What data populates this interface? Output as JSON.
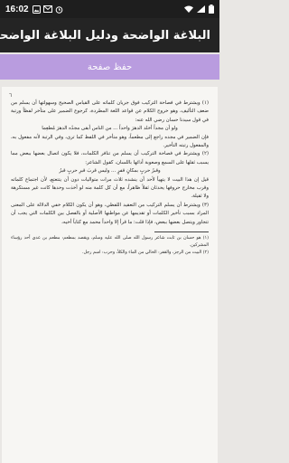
{
  "status_bar": {
    "time": "16:02",
    "left_icons": [
      "image-notification-icon",
      "mail-notification-icon",
      "alarm-icon"
    ],
    "right_icons": [
      "wifi-icon",
      "signal-icon",
      "battery-icon"
    ]
  },
  "app_bar": {
    "title": "البلاغة الواضحة ودليل البلاغة الواضحة"
  },
  "save_bar": {
    "label": "حفظ صفحة"
  },
  "page": {
    "page_mark": "٦",
    "paragraphs": [
      "(١) ويشترط في فصاحة التركيب فوق جريان كلماته على القياس الصحيح وسهولتها أن يسلم من ضعف التأليف، وهو خروج الكلام عن قواعد اللغة المطردة، كرجوع الضمير على متأخر لفظاً ورتبة في قول سيدنا حسان رضي الله عنه:",
      "ولو أن مجداً أخلد الدهرَ واحداً ... من الناس أبقى مجدُه الدهرَ مُطعِما",
      "فإن الضمير في مجده راجع إلى مطعماً، وهو متأخر في اللفظ كما ترى، وفي الرتبة لأنه مفعول به، والمفعول رتبته التأخير.",
      "(٢) ويشترط في فصاحة التركيب أن يسلم من تنافر الكلمات، فلا يكون اتصال بعضها ببعض مما يسبب ثقلها على السمع وصعوبة أدائها باللسان، كقول الشاعر:",
      "وقبرُ حربٍ بمكانٍ قفرٍ ... وليس قربَ قبرِ حربٍ قبرُ",
      "قيل إن هذا البيت لا يتهيأ لأحد أن ينشده ثلاث مرات متواليات دون أن يتتعتع، لأن اجتماع كلماته وقرب مخارج حروفها يحدثان ثقلاً ظاهراً، مع أن كل كلمة منه لو أخذت وحدها كانت غير مستكرهة ولا ثقيلة.",
      "(٣) ويشترط أن يسلم التركيب من التعقيد اللفظي، وهو أن يكون الكلام خفي الدلالة على المعنى المراد بسبب تأخير الكلمات أو تقديمها عن مواطنها الأصلية أو بالفصل بين الكلمات التي يجب أن تتجاور ويتصل بعضها ببعض، فإذا قلت: ما قرأ إلا واحداً محمد مع كتاباً أخيه،"
    ],
    "footnotes": [
      "(١) هو حسان بن ثابت شاعر رسول الله صلى الله عليه وسلم، ويقصد بمطعم: مطعم بن عدي أحد رؤساء المشركين.",
      "(٢) البيت من الرجز، والقفر: الخالي من الماء والكلأ، وحرب: اسم رجل."
    ]
  }
}
